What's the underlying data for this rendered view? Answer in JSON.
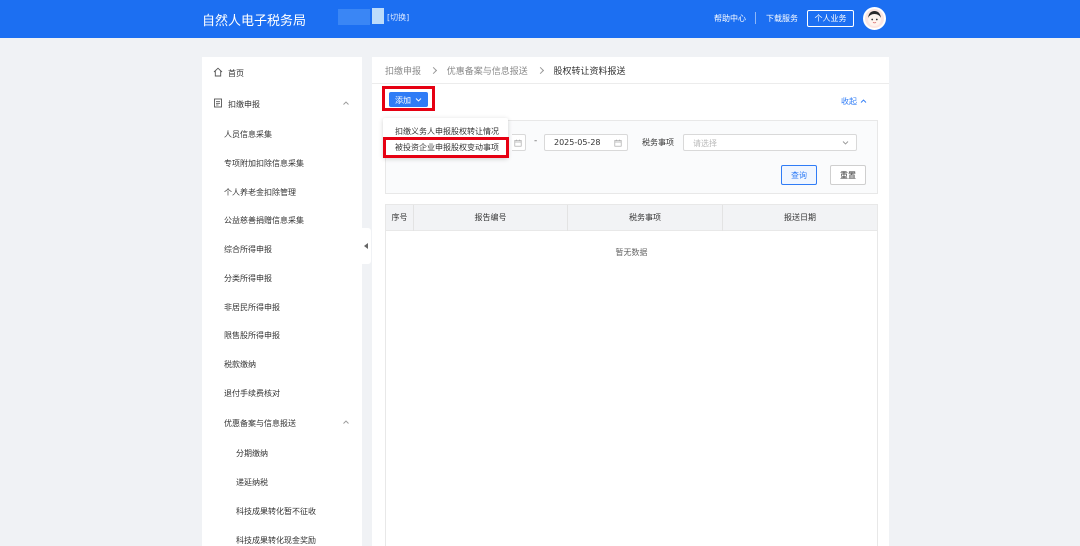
{
  "header": {
    "app_title": "自然人电子税务局",
    "switch_label": "[切换]",
    "help_label": "帮助中心",
    "download_label": "下载服务",
    "personal_label": "个人业务"
  },
  "sidebar": {
    "items": [
      {
        "label": "首页"
      },
      {
        "label": "扣缴申报"
      },
      {
        "label": "人员信息采集"
      },
      {
        "label": "专项附加扣除信息采集"
      },
      {
        "label": "个人养老金扣除管理"
      },
      {
        "label": "公益慈善捐赠信息采集"
      },
      {
        "label": "综合所得申报"
      },
      {
        "label": "分类所得申报"
      },
      {
        "label": "非居民所得申报"
      },
      {
        "label": "限售股所得申报"
      },
      {
        "label": "税款缴纳"
      },
      {
        "label": "退付手续费核对"
      },
      {
        "label": "优惠备案与信息报送"
      },
      {
        "label": "分期缴纳"
      },
      {
        "label": "递延纳税"
      },
      {
        "label": "科技成果转化暂不征收"
      },
      {
        "label": "科技成果转化现金奖励"
      }
    ]
  },
  "breadcrumb": {
    "items": [
      "扣缴申报",
      "优惠备案与信息报送",
      "股权转让资料报送"
    ]
  },
  "toolbar": {
    "add_label": "添加",
    "collapse_label": "收起"
  },
  "dropdown": {
    "items": [
      "扣缴义务人申报股权转让情况",
      "被投资企业申报股权变动事项"
    ]
  },
  "filter": {
    "date_separator": "-",
    "date_end": "2025-05-28",
    "tax_label": "税务事项",
    "tax_placeholder": "请选择",
    "query_label": "查询",
    "reset_label": "重置"
  },
  "table": {
    "columns": [
      "序号",
      "报告编号",
      "税务事项",
      "报送日期"
    ],
    "empty_text": "暂无数据"
  },
  "colors": {
    "header_bg": "#1c6ff2",
    "primary": "#2f7cf6",
    "highlight": "#e60012"
  }
}
